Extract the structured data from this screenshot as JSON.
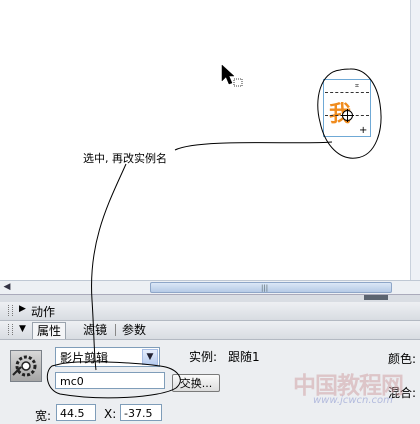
{
  "stage": {
    "callout_text": "选中, 再改实例名",
    "symbol_glyph": "我"
  },
  "panels": {
    "actions_label": "动作",
    "tabs": [
      {
        "label": "属性"
      },
      {
        "label": "滤镜"
      },
      {
        "label": "参数"
      }
    ]
  },
  "properties": {
    "symbol_type": "影片剪辑",
    "instance_name": "mc0",
    "instance_label": "实例:",
    "instance_of": "跟随1",
    "swap_label": "交换...",
    "color_label": "颜色:",
    "blend_label": "混合:",
    "width_label": "宽:",
    "width_value": "44.5",
    "x_label": "X:",
    "x_value": "-37.5"
  },
  "watermark": {
    "text": "中国教程网",
    "url": "www.jcwcn.com"
  },
  "colors": {
    "annotation_ink": "#000000",
    "glyph": "#f08c1e",
    "selection": "#6fa9d6"
  }
}
